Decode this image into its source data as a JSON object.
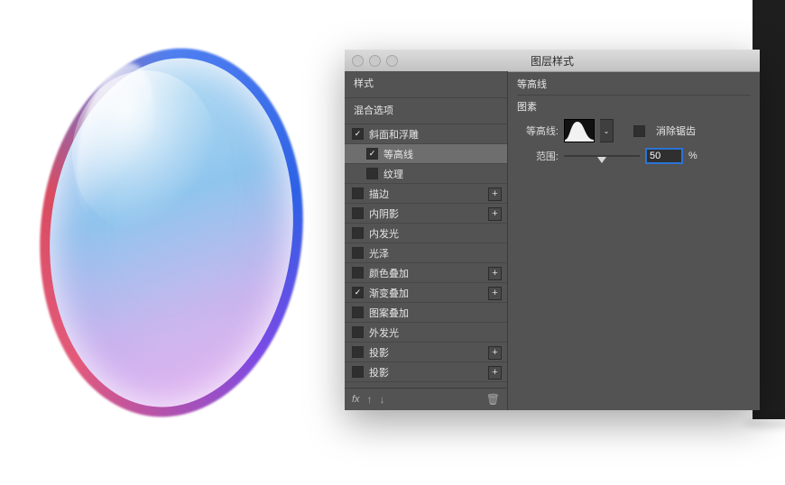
{
  "dialog": {
    "title": "图层样式",
    "left_header": "样式",
    "blend_options": "混合选项",
    "styles": [
      {
        "id": "bevel",
        "label": "斜面和浮雕",
        "checked": true,
        "selected": false,
        "add": false,
        "sub": 0
      },
      {
        "id": "contour",
        "label": "等高线",
        "checked": true,
        "selected": true,
        "add": false,
        "sub": 1
      },
      {
        "id": "texture",
        "label": "纹理",
        "checked": false,
        "selected": false,
        "add": false,
        "sub": 1
      },
      {
        "id": "stroke",
        "label": "描边",
        "checked": false,
        "selected": false,
        "add": true,
        "sub": 0
      },
      {
        "id": "inner-shadow",
        "label": "内阴影",
        "checked": false,
        "selected": false,
        "add": true,
        "sub": 0
      },
      {
        "id": "inner-glow",
        "label": "内发光",
        "checked": false,
        "selected": false,
        "add": false,
        "sub": 0
      },
      {
        "id": "satin",
        "label": "光泽",
        "checked": false,
        "selected": false,
        "add": false,
        "sub": 0
      },
      {
        "id": "color-overlay",
        "label": "颜色叠加",
        "checked": false,
        "selected": false,
        "add": true,
        "sub": 0
      },
      {
        "id": "grad-overlay",
        "label": "渐变叠加",
        "checked": true,
        "selected": false,
        "add": true,
        "sub": 0
      },
      {
        "id": "pat-overlay",
        "label": "图案叠加",
        "checked": false,
        "selected": false,
        "add": false,
        "sub": 0
      },
      {
        "id": "outer-glow",
        "label": "外发光",
        "checked": false,
        "selected": false,
        "add": false,
        "sub": 0
      },
      {
        "id": "shadow1",
        "label": "投影",
        "checked": false,
        "selected": false,
        "add": true,
        "sub": 0
      },
      {
        "id": "shadow2",
        "label": "投影",
        "checked": false,
        "selected": false,
        "add": true,
        "sub": 0
      }
    ],
    "footer": {
      "fx": "fx"
    }
  },
  "contour_panel": {
    "heading": "等高线",
    "elements_label": "图素",
    "contour_label": "等高线:",
    "anti_alias_label": "消除锯齿",
    "anti_alias_checked": false,
    "range_label": "范围:",
    "range_value": "50",
    "range_unit": "%"
  }
}
